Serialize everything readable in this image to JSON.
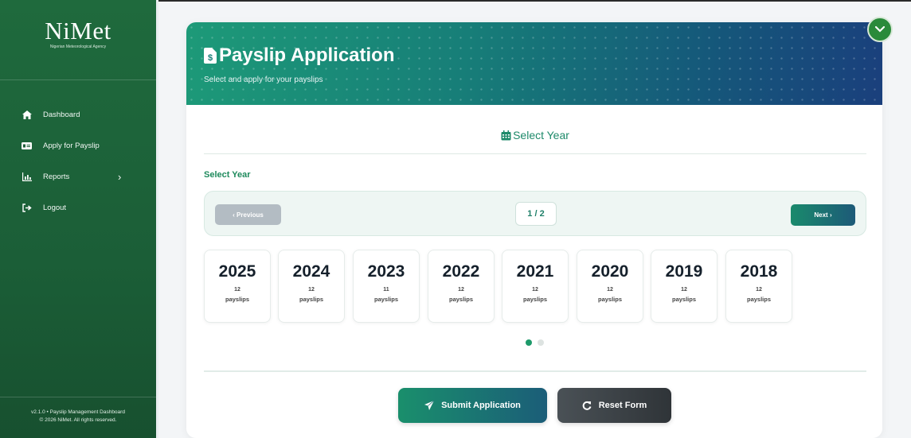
{
  "brand": {
    "name": "NiMet",
    "subtitle": "Nigerian Meteorological Agency"
  },
  "sidebar": {
    "items": [
      {
        "label": "Dashboard",
        "icon": "home-icon"
      },
      {
        "label": "Apply for Payslip",
        "icon": "id-card-icon"
      },
      {
        "label": "Reports",
        "icon": "chart-icon",
        "chevron": "›"
      },
      {
        "label": "Logout",
        "icon": "logout-icon"
      }
    ],
    "footer_line1": "v2.1.0 • Payslip Management Dashboard",
    "footer_line2": "© 2026 NiMet. All rights reserved."
  },
  "header": {
    "title": "Payslip Application",
    "subtitle": "Select and apply for your payslips"
  },
  "section": {
    "title": "Select Year",
    "label": "Select Year"
  },
  "pager": {
    "prev_label": "‹  Previous",
    "page_indicator": "1 / 2",
    "next_label": "Next  ›"
  },
  "years": [
    {
      "year": "2025",
      "count": "12",
      "unit": "payslips"
    },
    {
      "year": "2024",
      "count": "12",
      "unit": "payslips"
    },
    {
      "year": "2023",
      "count": "11",
      "unit": "payslips"
    },
    {
      "year": "2022",
      "count": "12",
      "unit": "payslips"
    },
    {
      "year": "2021",
      "count": "12",
      "unit": "payslips"
    },
    {
      "year": "2020",
      "count": "12",
      "unit": "payslips"
    },
    {
      "year": "2019",
      "count": "12",
      "unit": "payslips"
    },
    {
      "year": "2018",
      "count": "12",
      "unit": "payslips"
    }
  ],
  "pagination_dots": {
    "total": 2,
    "active": 1
  },
  "actions": {
    "submit_label": "Submit Application",
    "reset_label": "Reset Form"
  },
  "colors": {
    "accent": "#1e8a6a",
    "sidebar": "#1b5e37",
    "brand_gradient_end": "#1a3f7c"
  }
}
